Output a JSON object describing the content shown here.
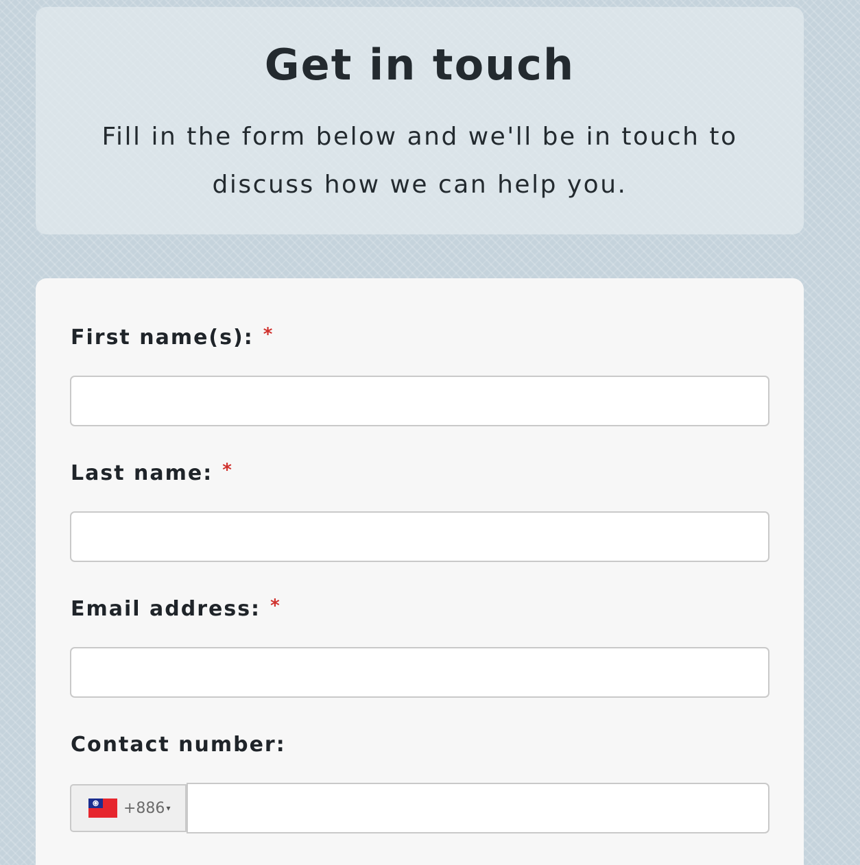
{
  "header": {
    "title": "Get in touch",
    "subtitle": "Fill in the form below and we'll be in touch to discuss how we can help you."
  },
  "form": {
    "required_marker": "*",
    "fields": [
      {
        "label": "First name(s):",
        "value": "",
        "required": true
      },
      {
        "label": "Last name:",
        "value": "",
        "required": true
      },
      {
        "label": "Email address:",
        "value": "",
        "required": true
      },
      {
        "label": "Contact number:",
        "value": "",
        "required": false
      }
    ],
    "phone": {
      "country_flag": "taiwan-flag-icon",
      "dial_code": "+886",
      "caret": "▾",
      "value": ""
    }
  },
  "colors": {
    "required": "#d0312d",
    "text": "#232a2f",
    "background": "#c5d3dc"
  }
}
